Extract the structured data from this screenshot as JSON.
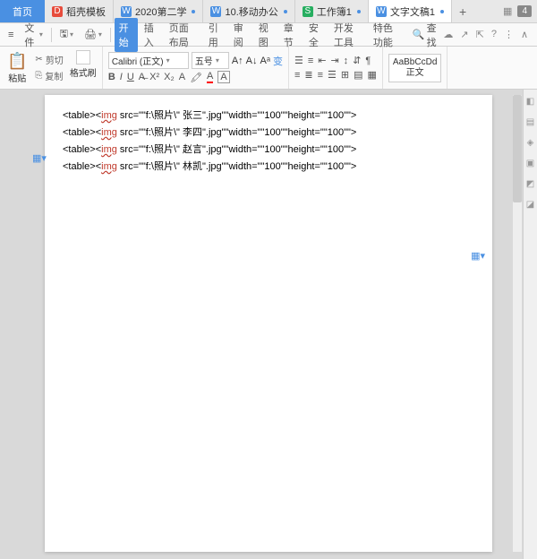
{
  "tabs": {
    "home": "首页",
    "t1": "稻壳模板",
    "t2": "2020第二学",
    "t3": "10.移动办公",
    "t4": "工作簿1",
    "t5": "文字文稿1",
    "badge": "4"
  },
  "menu": {
    "file": "文件",
    "items": [
      "开始",
      "插入",
      "页面布局",
      "引用",
      "审阅",
      "视图",
      "章节",
      "安全",
      "开发工具",
      "特色功能"
    ],
    "find": "查找"
  },
  "ribbon": {
    "paste": "粘贴",
    "cut": "剪切",
    "copy": "复制",
    "fmt": "格式刷",
    "font_name": "Calibri (正文)",
    "font_size": "五号",
    "style_preview": "AaBbCcDd",
    "style_name": "正文"
  },
  "doc": {
    "lines": [
      {
        "p1": "<table><",
        "p2": "img",
        "p3": " src=\"\"f:\\照片\\\" 张三\".jpg\"\"width=\"\"100\"\"height=\"\"100\"\">"
      },
      {
        "p1": "<table><",
        "p2": "img",
        "p3": " src=\"\"f:\\照片\\\" 李四\".jpg\"\"width=\"\"100\"\"height=\"\"100\"\">"
      },
      {
        "p1": "<table><",
        "p2": "img",
        "p3": " src=\"\"f:\\照片\\\" 赵言\".jpg\"\"width=\"\"100\"\"height=\"\"100\"\">"
      },
      {
        "p1": "<table><",
        "p2": "img",
        "p3": " src=\"\"f:\\照片\\\" 林凯\".jpg\"\"width=\"\"100\"\"height=\"\"100\"\">"
      }
    ]
  }
}
